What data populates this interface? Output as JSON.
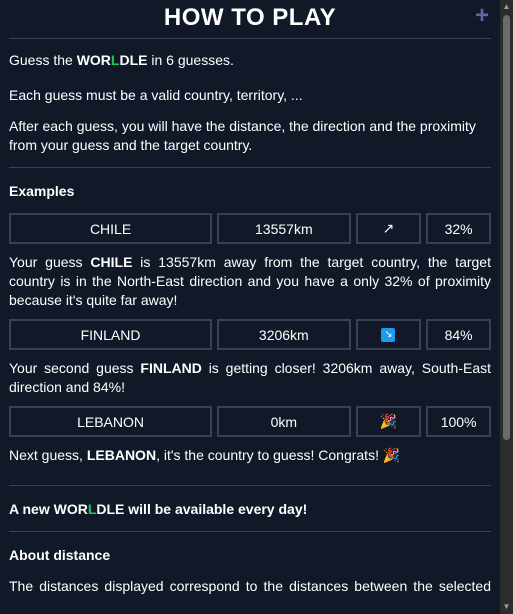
{
  "header": {
    "title": "HOW TO PLAY",
    "close_icon": "+"
  },
  "intro": {
    "line1_pre": "Guess the ",
    "brand_a": "WOR",
    "brand_l": "L",
    "brand_b": "DLE",
    "line1_post": " in 6 guesses.",
    "line2": "Each guess must be a valid country, territory, ...",
    "line3": "After each guess, you will have the distance, the direction and the proximity from your guess and the target country."
  },
  "examples": {
    "heading": "Examples",
    "rows": [
      {
        "country": "CHILE",
        "distance": "13557km",
        "direction": "↗",
        "proximity": "32%",
        "desc_pre": "Your guess ",
        "desc_bold": "CHILE",
        "desc_post": " is 13557km away from the target country, the target country is in the North-East direction and you have a only 32% of proximity because it's quite far away!"
      },
      {
        "country": "FINLAND",
        "distance": "3206km",
        "direction": "↘",
        "proximity": "84%",
        "desc_pre": "Your second guess ",
        "desc_bold": "FINLAND",
        "desc_post": " is getting closer! 3206km away, South-East direction and 84%!"
      },
      {
        "country": "LEBANON",
        "distance": "0km",
        "direction": "🎉",
        "proximity": "100%",
        "desc_pre": "Next guess, ",
        "desc_bold": "LEBANON",
        "desc_post": ", it's the country to guess! Congrats! 🎉"
      }
    ]
  },
  "daily": {
    "pre": "A new ",
    "brand_a": "WOR",
    "brand_l": "L",
    "brand_b": "DLE",
    "post": " will be available every day!"
  },
  "about": {
    "heading": "About distance",
    "text": "The distances displayed correspond to the distances between the selected"
  },
  "colors": {
    "background": "#111827",
    "border": "#374151",
    "accent_green": "#22c55e",
    "close": "#6b5fa8"
  }
}
